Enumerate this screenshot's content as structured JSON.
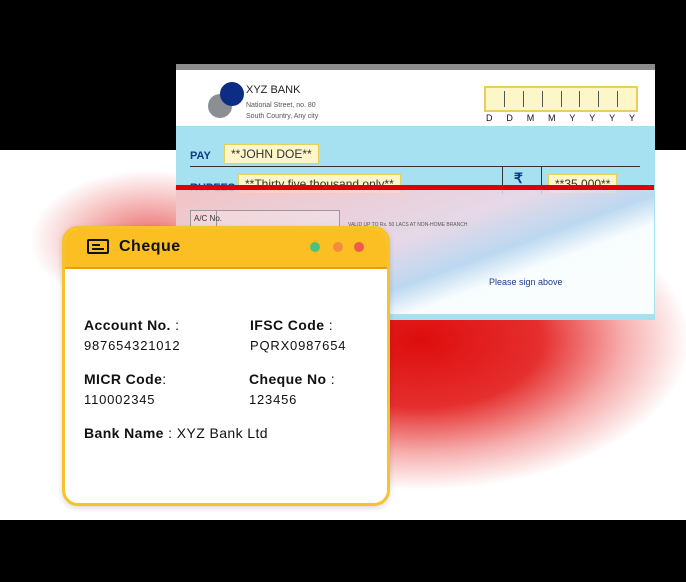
{
  "cheque": {
    "bank_name": "XYZ BANK",
    "address_line1": "National Street, no. 80",
    "address_line2": "South Country, Any city",
    "date_format": [
      "D",
      "D",
      "M",
      "M",
      "Y",
      "Y",
      "Y",
      "Y"
    ],
    "pay_label": "PAY",
    "pay_value": "**JOHN DOE**",
    "rupees_label": "RUPEES",
    "rupees_value": "**Thirty five thousand only**",
    "rupee_symbol": "₹",
    "amount_value": "**35,000**",
    "account_label": "A/C No.",
    "validity_note": "VALID UP TO Rs. 50 LACS AT NON-HOME BRANCH",
    "sign_note": "Please sign above"
  },
  "card": {
    "title": "Cheque",
    "account_no_label": "Account No.",
    "account_no_value": "987654321012",
    "ifsc_label": "IFSC Code",
    "ifsc_value": "PQRX0987654",
    "micr_label": "MICR Code",
    "micr_value": "110002345",
    "cheque_no_label": "Cheque No",
    "cheque_no_value": "123456",
    "bank_name_label": "Bank Name",
    "bank_name_value": "XYZ Bank Ltd",
    "label_suffix": ":"
  },
  "colors": {
    "card_header": "#fbbf24",
    "cheque_field_bg": "#a6e1f2",
    "splash": "#e00000",
    "bank_blue": "#0c2d83"
  },
  "icons": [
    "cheque-icon",
    "window-dot-green",
    "window-dot-orange",
    "window-dot-red"
  ]
}
